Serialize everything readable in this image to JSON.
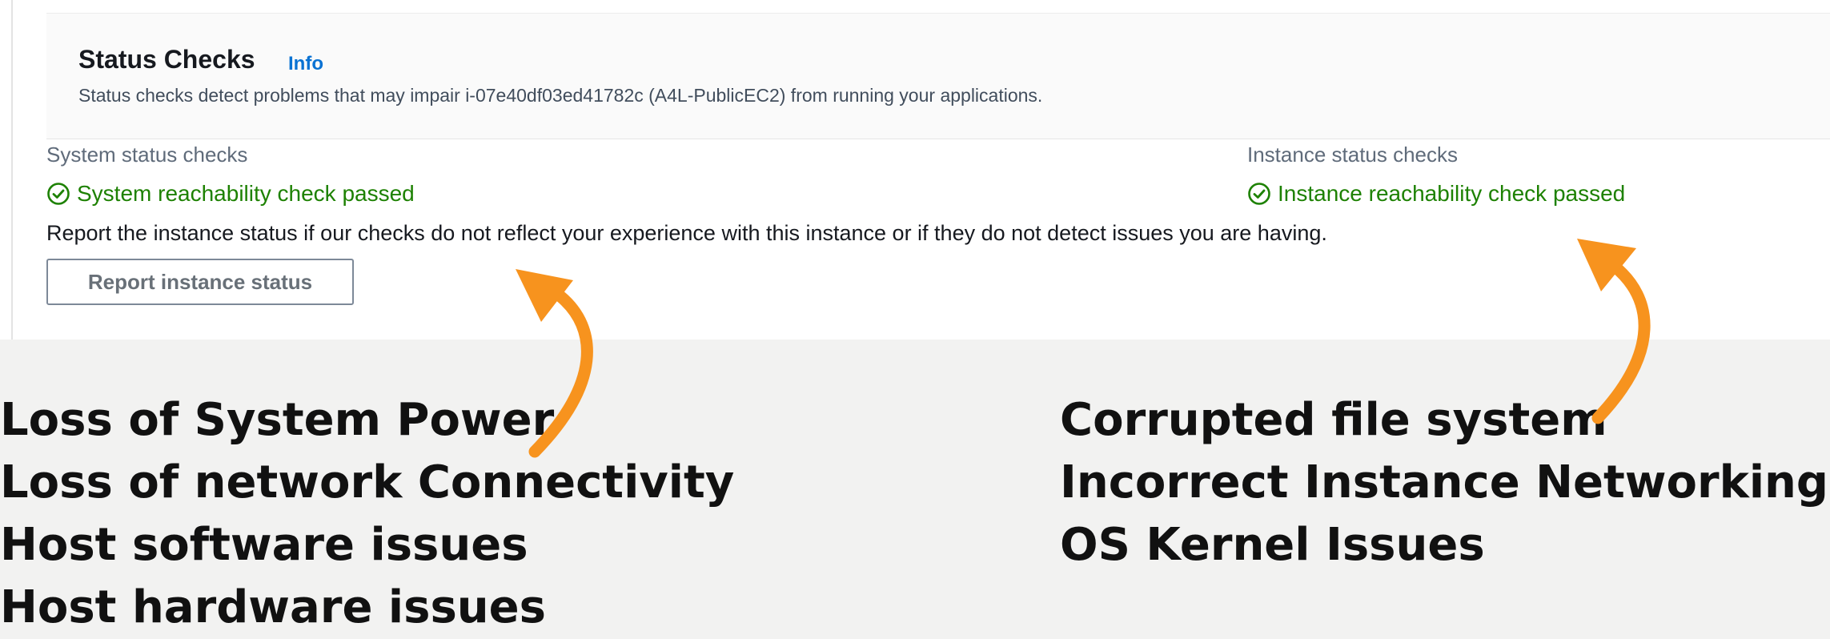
{
  "status_checks": {
    "title": "Status Checks",
    "info_label": "Info",
    "description": "Status checks detect problems that may impair i-07e40df03ed41782c (A4L-PublicEC2) from running your applications.",
    "system": {
      "label": "System status checks",
      "result": "System reachability check passed"
    },
    "instance": {
      "label": "Instance status checks",
      "result": "Instance reachability check passed"
    },
    "report_text": "Report the instance status if our checks do not reflect your experience with this instance or if they do not detect issues you are having.",
    "report_button": "Report instance status"
  },
  "annotations": {
    "system_issues": [
      "Loss of System Power",
      "Loss of network Connectivity",
      "Host software issues",
      "Host hardware issues"
    ],
    "instance_issues": [
      "Corrupted file system",
      "Incorrect Instance Networking",
      "OS Kernel Issues"
    ]
  },
  "colors": {
    "passed": "#1d8102",
    "info_link": "#0972d3",
    "arrow": "#f7931e"
  },
  "icons": {
    "check": "check-circle-icon",
    "arrow": "curved-arrow-up-icon"
  }
}
